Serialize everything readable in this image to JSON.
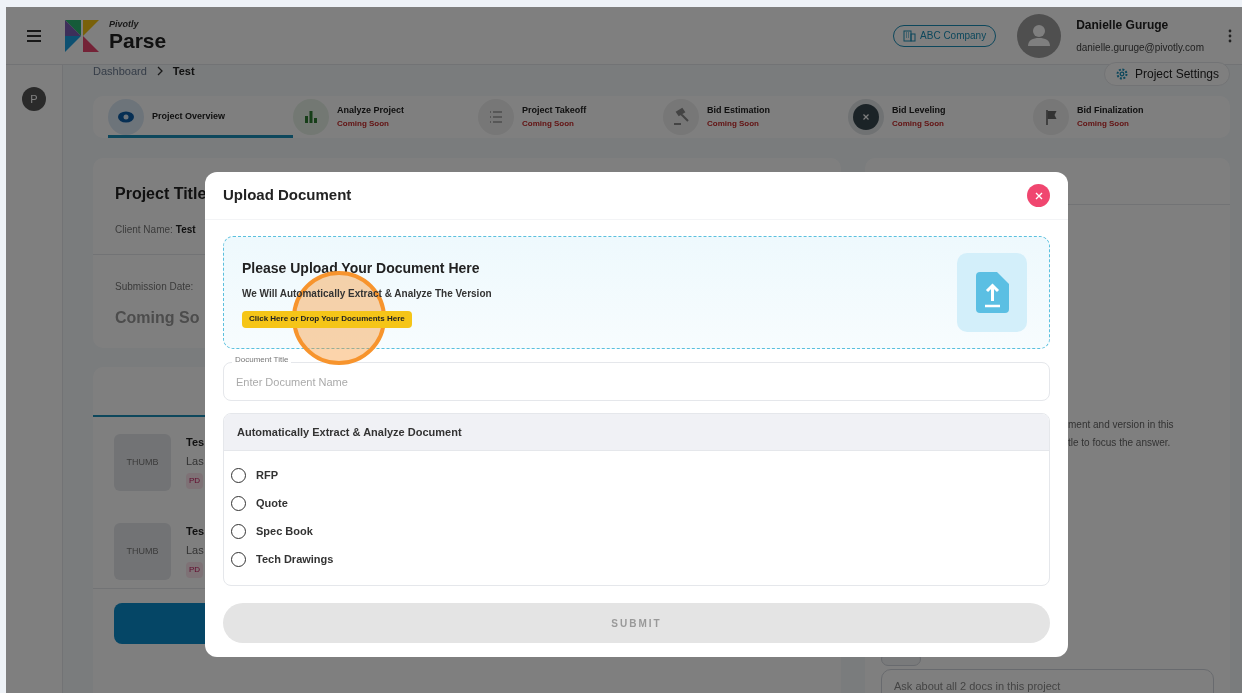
{
  "header": {
    "logo_small": "Pivotly",
    "logo_title": "Parse",
    "company": "ABC Company",
    "user": {
      "name": "Danielle Guruge",
      "email": "danielle.guruge@pivotly.com"
    }
  },
  "sidebar": {
    "avatar": "P"
  },
  "breadcrumb": [
    {
      "label": "Dashboard",
      "current": false
    },
    {
      "label": "Test",
      "current": true
    }
  ],
  "project_settings": "Project Settings",
  "steps": [
    {
      "label": "Project Overview",
      "selected": true
    },
    {
      "label": "Analyze Project",
      "status": "Coming Soon",
      "selected": false
    },
    {
      "label": "Project Takeoff",
      "status": "Coming Soon",
      "selected": false
    },
    {
      "label": "Bid Estimation",
      "status": "Coming Soon",
      "selected": false
    },
    {
      "label": "Bid Leveling",
      "status": "Coming Soon",
      "selected": false
    },
    {
      "label": "Bid Finalization",
      "status": "Coming Soon",
      "selected": false
    }
  ],
  "project_card": {
    "title": "Project Title",
    "client_label": "Client Name:",
    "client_value": "Test",
    "submission_label": "Submission Date:",
    "submission_value": "Coming So"
  },
  "documents": [
    {
      "thumb": "THUMB",
      "title": "Tes",
      "meta": "Las",
      "tag": "PD"
    },
    {
      "thumb": "THUMB",
      "title": "Tes",
      "meta": "Las",
      "tag": "PD"
    }
  ],
  "right_panel": {
    "lines": [
      "ment and version in this",
      "tle to focus the answer."
    ],
    "ask_placeholder": "Ask about all 2 docs in this project"
  },
  "modal": {
    "title": "Upload Document",
    "drop_title": "Please Upload Your Document Here",
    "drop_subtitle": "We Will Automatically Extract & Analyze The Version",
    "drop_button": "Click Here or Drop Your Documents Here",
    "field_label": "Document Title",
    "field_placeholder": "Enter Document Name",
    "section_title": "Automatically Extract & Analyze Document",
    "options": [
      {
        "label": "RFP",
        "selected": false
      },
      {
        "label": "Quote",
        "selected": false
      },
      {
        "label": "Spec Book",
        "selected": false
      },
      {
        "label": "Tech Drawings",
        "selected": false
      }
    ],
    "submit": "SUBMIT",
    "submit_disabled": true
  }
}
